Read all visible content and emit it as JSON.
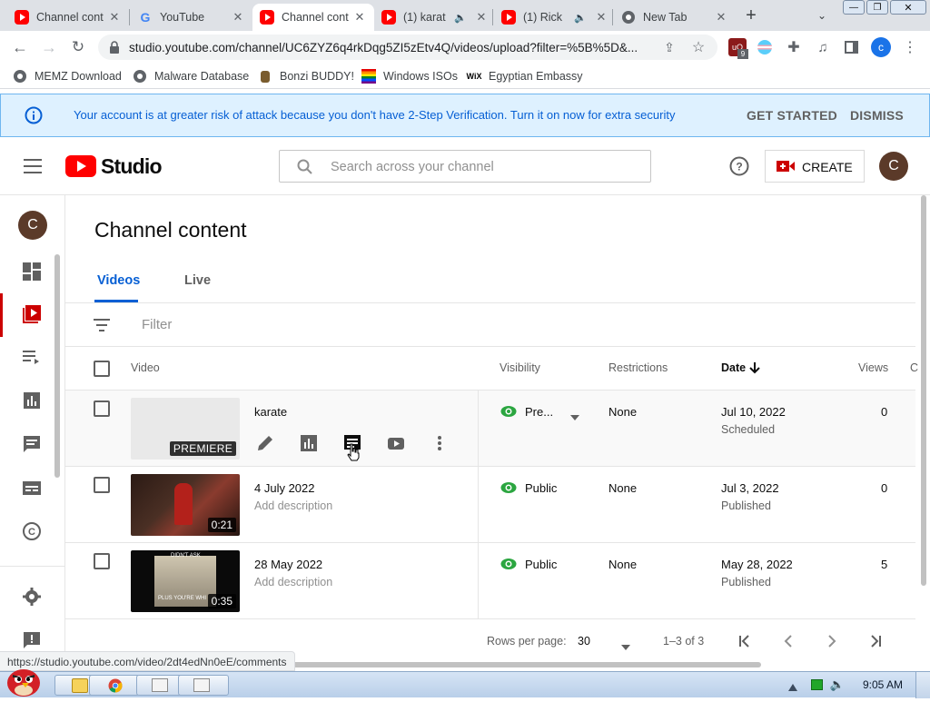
{
  "browser": {
    "tabs": [
      {
        "title": "Channel cont",
        "favicon": "youtube-icon",
        "active": false
      },
      {
        "title": "YouTube",
        "favicon": "google-icon",
        "active": false
      },
      {
        "title": "Channel cont",
        "favicon": "youtube-icon",
        "active": true
      },
      {
        "title": "(1) karat",
        "favicon": "youtube-icon",
        "active": false,
        "audio": true
      },
      {
        "title": "(1) Rick",
        "favicon": "youtube-icon",
        "active": false,
        "audio": true
      },
      {
        "title": "New Tab",
        "favicon": "chrome-icon",
        "active": false
      }
    ],
    "new_tab_label": "+",
    "url": "studio.youtube.com/channel/UC6ZYZ6q4rkDqg5ZI5zEtv4Q/videos/upload?filter=%5B%5D&...",
    "extension_badge": "9",
    "profile_initial": "c",
    "bookmarks": [
      "MEMZ Download",
      "Malware Database",
      "Bonzi BUDDY!",
      "Windows ISOs",
      "Egyptian Embassy"
    ]
  },
  "banner": {
    "message": "Your account is at greater risk of attack because you don't have 2-Step Verification. Turn it on now for extra security",
    "get_started": "GET STARTED",
    "dismiss": "DISMISS"
  },
  "header": {
    "logo_text": "Studio",
    "search_placeholder": "Search across your channel",
    "create_label": "CREATE",
    "avatar_initial": "C"
  },
  "sidebar": {
    "avatar_initial": "C"
  },
  "main": {
    "title": "Channel content",
    "tabs": [
      "Videos",
      "Live"
    ],
    "filter_label": "Filter",
    "columns": {
      "video": "Video",
      "visibility": "Visibility",
      "restrictions": "Restrictions",
      "date": "Date",
      "views": "Views",
      "comments": "C"
    },
    "rows": [
      {
        "title": "karate",
        "description": "",
        "badge": "PREMIERE",
        "duration": "",
        "visibility": "Pre...",
        "restrictions": "None",
        "date": "Jul 10, 2022",
        "date_status": "Scheduled",
        "views": "0"
      },
      {
        "title": "4 July 2022",
        "description": "Add description",
        "badge": "",
        "duration": "0:21",
        "visibility": "Public",
        "restrictions": "None",
        "date": "Jul 3, 2022",
        "date_status": "Published",
        "views": "0"
      },
      {
        "title": "28 May 2022",
        "description": "Add description",
        "badge": "",
        "duration": "0:35",
        "visibility": "Public",
        "restrictions": "None",
        "date": "May 28, 2022",
        "date_status": "Published",
        "views": "5"
      }
    ],
    "thumb_caption_3a": "DIDN'T ASK",
    "thumb_caption_3b": "PLUS YOU'RE WHI"
  },
  "pagination": {
    "rows_per_page_label": "Rows per page:",
    "rows_per_page_value": "30",
    "range": "1–3 of 3"
  },
  "status_url": "https://studio.youtube.com/video/2dt4edNn0eE/comments",
  "taskbar": {
    "clock": "9:05 AM"
  },
  "colors": {
    "accent": "#065fd4",
    "youtube_red": "#ff0000",
    "visibility_green": "#2ba640",
    "banner_bg": "#def1ff"
  }
}
